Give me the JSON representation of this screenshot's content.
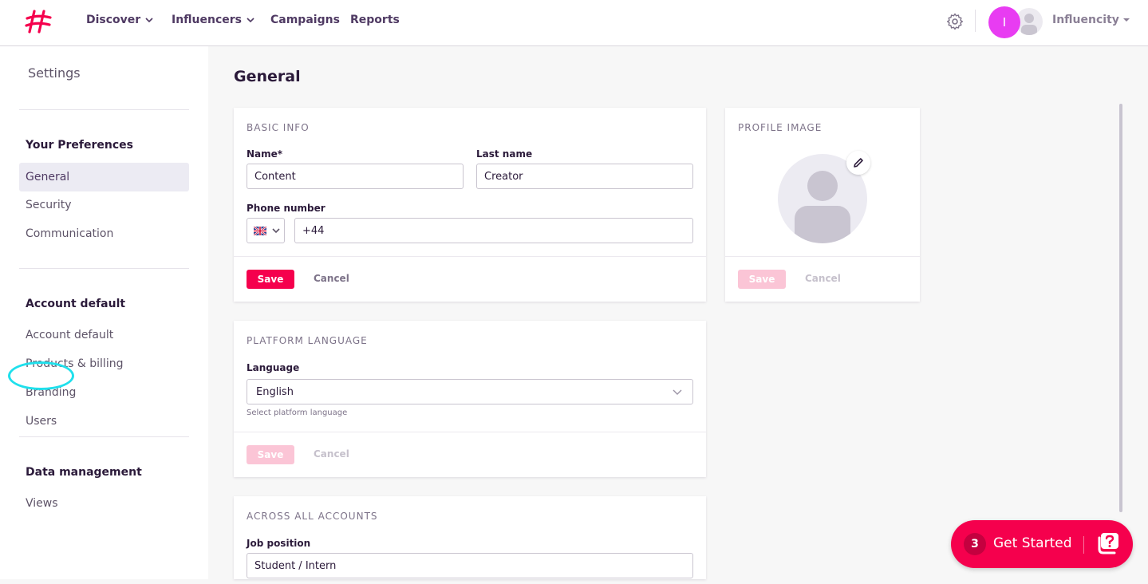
{
  "nav": {
    "items": [
      {
        "label": "Discover",
        "has_caret": true
      },
      {
        "label": "Influencers",
        "has_caret": true
      },
      {
        "label": "Campaigns",
        "has_caret": false
      },
      {
        "label": "Reports",
        "has_caret": false
      }
    ],
    "avatar_letter": "I",
    "account_name": "Influencity"
  },
  "sidebar": {
    "title": "Settings",
    "sections": [
      {
        "heading": "Your Preferences",
        "items": [
          "General",
          "Security",
          "Communication"
        ],
        "active": "General"
      },
      {
        "heading": "Account default",
        "items": [
          "Account default",
          "Products & billing",
          "Branding",
          "Users"
        ]
      },
      {
        "heading": "Data management",
        "items": [
          "Views"
        ]
      }
    ]
  },
  "page": {
    "title": "General"
  },
  "basic_info": {
    "heading": "BASIC INFO",
    "name_label": "Name*",
    "name_value": "Content",
    "last_name_label": "Last name",
    "last_name_value": "Creator",
    "phone_label": "Phone number",
    "phone_value": "+44",
    "country_flag": "uk-flag-icon",
    "save": "Save",
    "cancel": "Cancel"
  },
  "profile_image": {
    "heading": "PROFILE IMAGE",
    "save": "Save",
    "cancel": "Cancel"
  },
  "platform_language": {
    "heading": "PLATFORM LANGUAGE",
    "label": "Language",
    "value": "English",
    "hint": "Select platform language",
    "save": "Save",
    "cancel": "Cancel"
  },
  "across_accounts": {
    "heading": "ACROSS ALL ACCOUNTS",
    "job_label": "Job position",
    "job_value": "Student / Intern"
  },
  "get_started": {
    "count": "3",
    "label": "Get Started"
  },
  "colors": {
    "accent": "#f5004d",
    "avatar": "#e83cf2",
    "highlight": "#1fe0ec"
  }
}
